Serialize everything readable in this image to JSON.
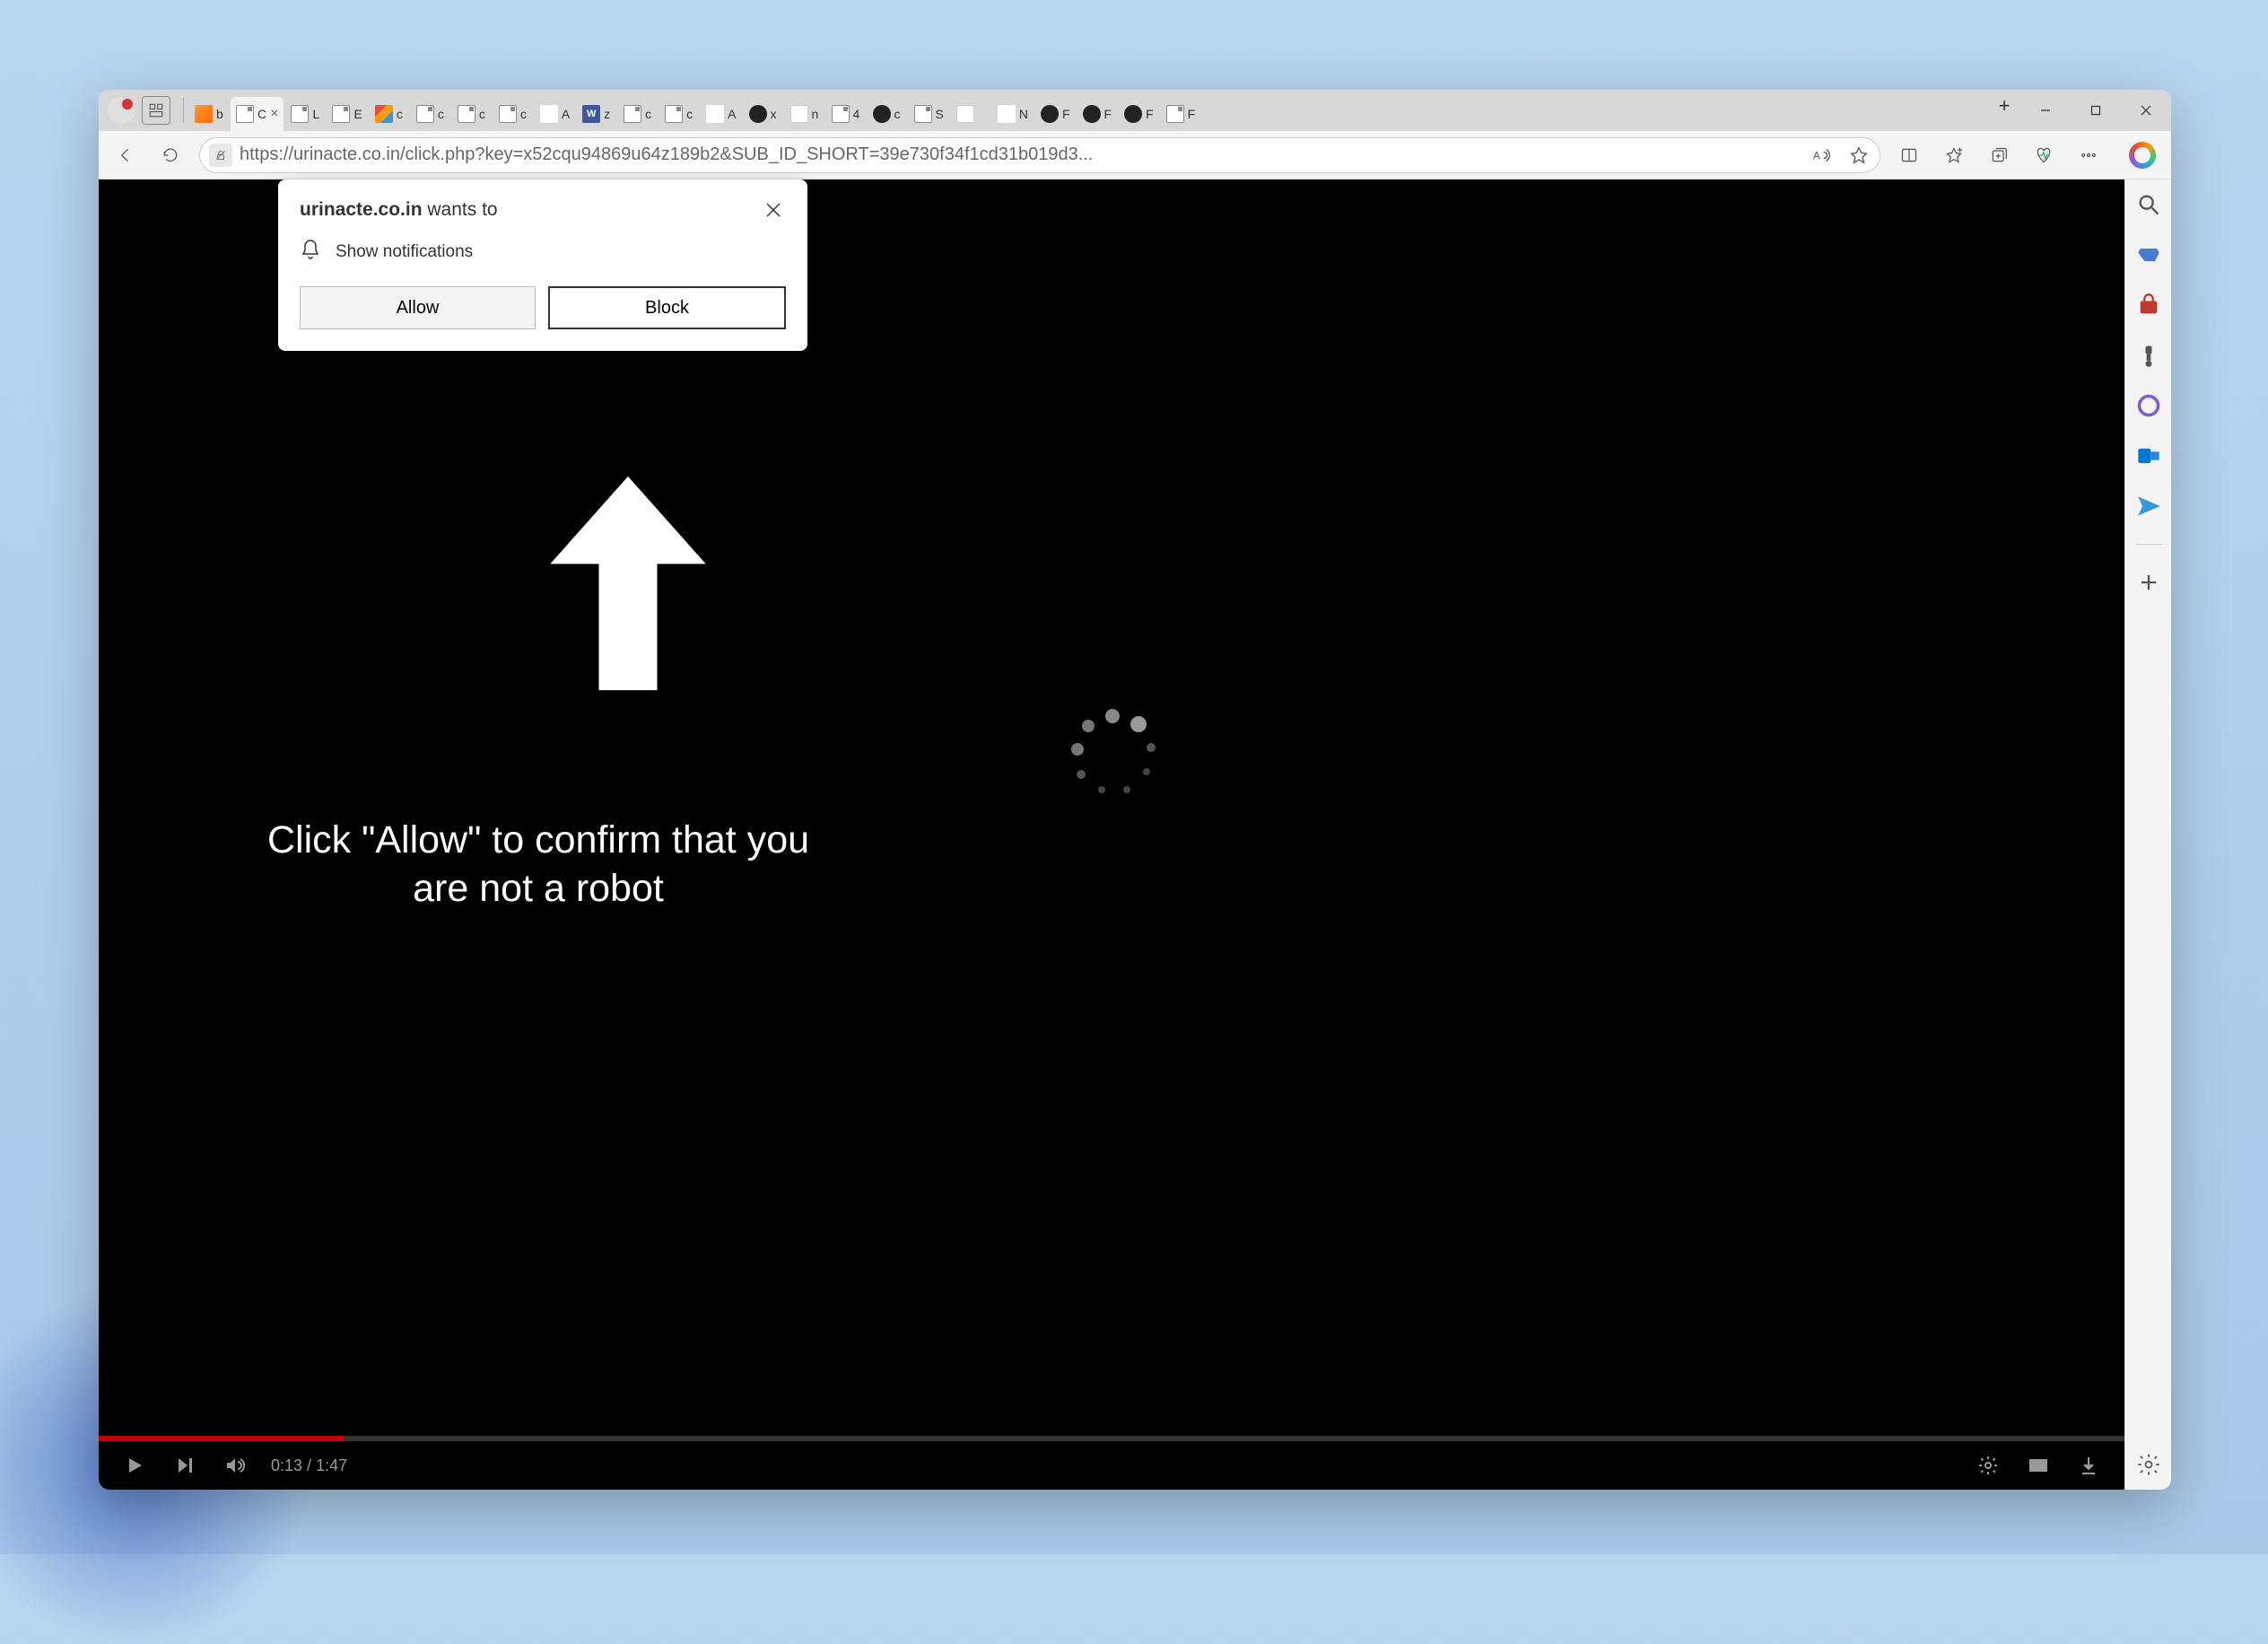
{
  "browser": {
    "url": "https://urinacte.co.in/click.php?key=x52cqu94869u64z189b2&SUB_ID_SHORT=39e730f34f1cd31b019d3..."
  },
  "tabs": [
    {
      "label": "b",
      "favicon": "orange"
    },
    {
      "label": "C",
      "favicon": "page",
      "active": true
    },
    {
      "label": "L",
      "favicon": "page"
    },
    {
      "label": "E",
      "favicon": "page"
    },
    {
      "label": "c",
      "favicon": "multi"
    },
    {
      "label": "c",
      "favicon": "page"
    },
    {
      "label": "c",
      "favicon": "page"
    },
    {
      "label": "c",
      "favicon": "page"
    },
    {
      "label": "A",
      "favicon": "dots"
    },
    {
      "label": "z",
      "favicon": "w"
    },
    {
      "label": "c",
      "favicon": "page"
    },
    {
      "label": "c",
      "favicon": "page"
    },
    {
      "label": "A",
      "favicon": "spin"
    },
    {
      "label": "x",
      "favicon": "dark"
    },
    {
      "label": "n",
      "favicon": "white"
    },
    {
      "label": "4",
      "favicon": "page"
    },
    {
      "label": "c",
      "favicon": "dark"
    },
    {
      "label": "S",
      "favicon": "page"
    },
    {
      "label": "",
      "favicon": "white"
    },
    {
      "label": "N",
      "favicon": "dots"
    },
    {
      "label": "F",
      "favicon": "dark"
    },
    {
      "label": "F",
      "favicon": "dark"
    },
    {
      "label": "F",
      "favicon": "dark"
    },
    {
      "label": "F",
      "favicon": "page"
    }
  ],
  "notification": {
    "site": "urinacte.co.in",
    "wants_to": "wants to",
    "permission_label": "Show notifications",
    "allow_label": "Allow",
    "block_label": "Block"
  },
  "page": {
    "robot_text": "Click \"Allow\" to confirm that you are not a robot"
  },
  "video": {
    "current_time": "0:13",
    "duration": "1:47",
    "progress_percent": 12.1
  }
}
